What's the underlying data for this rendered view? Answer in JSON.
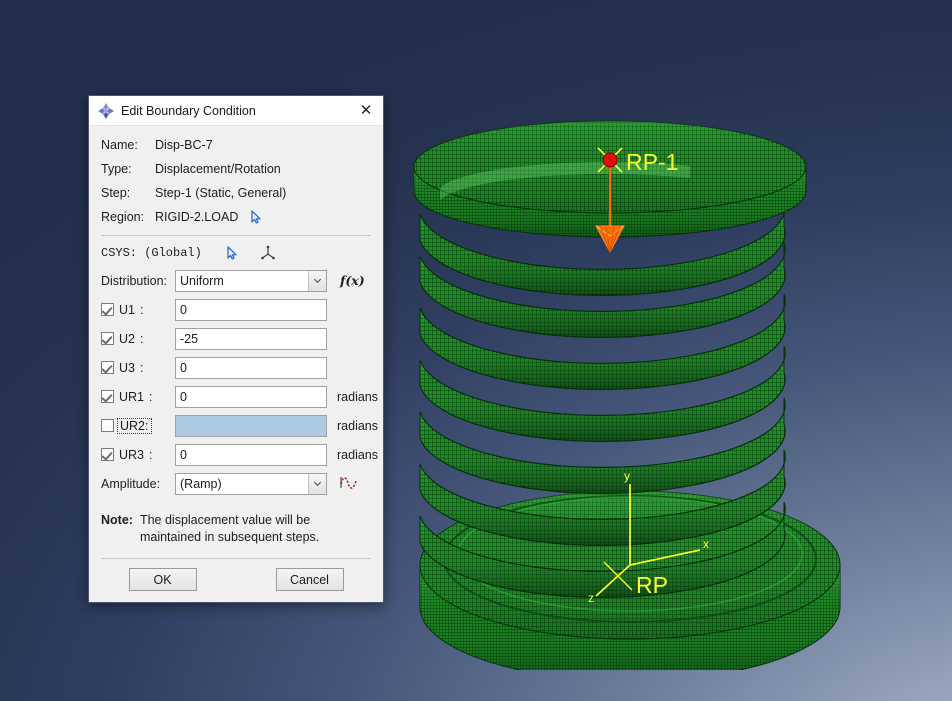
{
  "dialog": {
    "title": "Edit Boundary Condition",
    "title_icon": "abaqus-diamond-icon",
    "close_icon": "close-icon",
    "info": [
      {
        "label": "Name:",
        "value": "Disp-BC-7"
      },
      {
        "label": "Type:",
        "value": "Displacement/Rotation"
      },
      {
        "label": "Step:",
        "value": "Step-1 (Static, General)"
      },
      {
        "label": "Region:",
        "value": "RIGID-2.LOAD",
        "icon": "pick-cursor-icon"
      }
    ],
    "csys": {
      "label": "CSYS: (Global)",
      "edit_icon": "pick-cursor-icon",
      "create_icon": "datum-triad-icon"
    },
    "distribution": {
      "label": "Distribution:",
      "value": "Uniform",
      "options": [
        "Uniform"
      ],
      "fx_label": "f(x)"
    },
    "dof_fields": [
      {
        "name": "U1",
        "checked": true,
        "value": "0",
        "unit": "",
        "disabled": false,
        "focused": false
      },
      {
        "name": "U2",
        "checked": true,
        "value": "-25",
        "unit": "",
        "disabled": false,
        "focused": false
      },
      {
        "name": "U3",
        "checked": true,
        "value": "0",
        "unit": "",
        "disabled": false,
        "focused": false
      },
      {
        "name": "UR1",
        "checked": true,
        "value": "0",
        "unit": "radians",
        "disabled": false,
        "focused": false
      },
      {
        "name": "UR2",
        "checked": false,
        "value": "",
        "unit": "radians",
        "disabled": true,
        "focused": true
      },
      {
        "name": "UR3",
        "checked": true,
        "value": "0",
        "unit": "radians",
        "disabled": false,
        "focused": false
      }
    ],
    "amplitude": {
      "label": "Amplitude:",
      "value": "(Ramp)",
      "options": [
        "(Ramp)"
      ],
      "icon": "amplitude-wave-icon"
    },
    "note": {
      "key": "Note:",
      "text": "The displacement value will be maintained in subsequent steps."
    },
    "buttons": {
      "ok": "OK",
      "cancel": "Cancel"
    }
  },
  "viewport": {
    "annotations": {
      "rp1_label": "RP-1",
      "rp_label": "RP",
      "triad_x": "x",
      "triad_y": "y",
      "triad_z": "z"
    },
    "colors": {
      "mesh_green": "#1b8a23",
      "mesh_dark": "#0c4a12",
      "annotation_yellow": "#ffff2a",
      "arrow_orange": "#ff6a00",
      "node_red": "#e01010",
      "bg_dark": "#22304d",
      "bg_light": "#aebaca"
    }
  }
}
